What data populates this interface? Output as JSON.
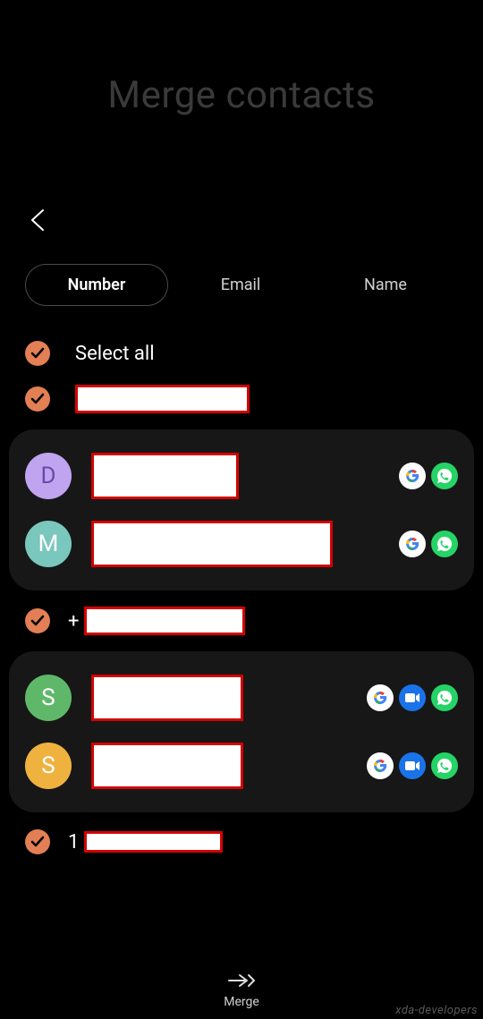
{
  "header": {
    "title": "Merge contacts"
  },
  "tabs": {
    "number": "Number",
    "email": "Email",
    "name": "Name",
    "active": "number"
  },
  "select_all": {
    "label": "Select all",
    "checked": true
  },
  "groups": [
    {
      "type": "header_row",
      "checked": true,
      "label_redacted": true
    },
    {
      "type": "card",
      "contacts": [
        {
          "initial": "D",
          "avatar_color": "purple",
          "services": [
            "google",
            "whatsapp"
          ],
          "name_redacted": true
        },
        {
          "initial": "M",
          "avatar_color": "teal",
          "services": [
            "google",
            "whatsapp"
          ],
          "name_redacted": true
        }
      ]
    },
    {
      "type": "header_row",
      "checked": true,
      "prefix": "+",
      "label_redacted": true
    },
    {
      "type": "card",
      "contacts": [
        {
          "initial": "S",
          "avatar_color": "green",
          "services": [
            "google",
            "duo",
            "whatsapp"
          ],
          "name_redacted": true
        },
        {
          "initial": "S",
          "avatar_color": "orange",
          "services": [
            "google",
            "duo",
            "whatsapp"
          ],
          "name_redacted": true
        }
      ]
    },
    {
      "type": "header_row",
      "checked": true,
      "prefix": "1",
      "label_redacted": true
    }
  ],
  "bottom_bar": {
    "merge_label": "Merge"
  },
  "watermark": "xda-developers"
}
